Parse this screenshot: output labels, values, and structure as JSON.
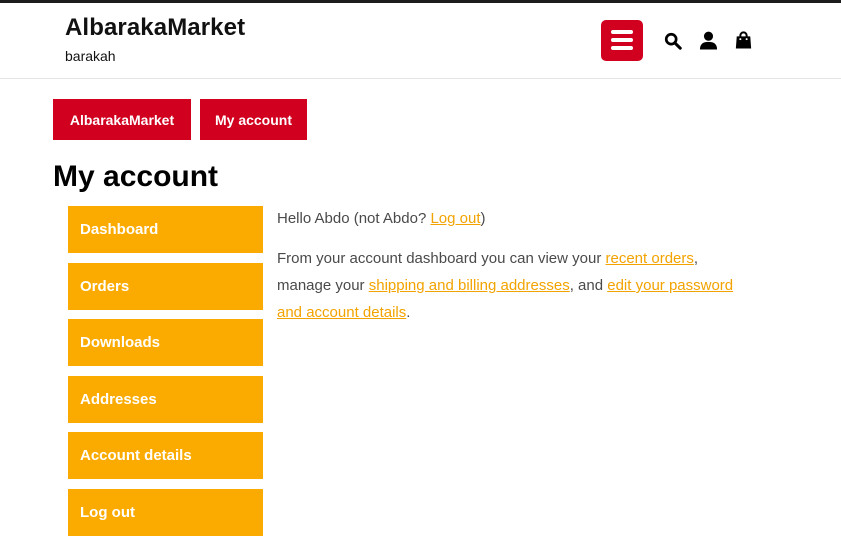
{
  "header": {
    "site_title": "AlbarakaMarket",
    "tagline": "barakah",
    "icons": [
      "menu-icon",
      "search-icon",
      "user-icon",
      "shopping-bag-icon"
    ]
  },
  "breadcrumb": {
    "home": "AlbarakaMarket",
    "current": "My account"
  },
  "page": {
    "title": "My account"
  },
  "account_nav": {
    "items": [
      {
        "label": "Dashboard"
      },
      {
        "label": "Orders"
      },
      {
        "label": "Downloads"
      },
      {
        "label": "Addresses"
      },
      {
        "label": "Account details"
      },
      {
        "label": "Log out"
      }
    ]
  },
  "dashboard": {
    "hello_prefix": "Hello Abdo (not Abdo? ",
    "logout_link": "Log out",
    "hello_suffix": ")",
    "intro_prefix": "From your account dashboard you can view your ",
    "recent_orders_link": "recent orders",
    "intro_mid1": ", manage your ",
    "addresses_link": "shipping and billing addresses",
    "intro_mid2": ", and ",
    "account_details_link": "edit your password and account details",
    "intro_suffix": "."
  },
  "colors": {
    "brand_red": "#d1001f",
    "nav_orange": "#fbab00",
    "link_orange": "#f2a300",
    "text_gray": "#4a4a4a"
  }
}
